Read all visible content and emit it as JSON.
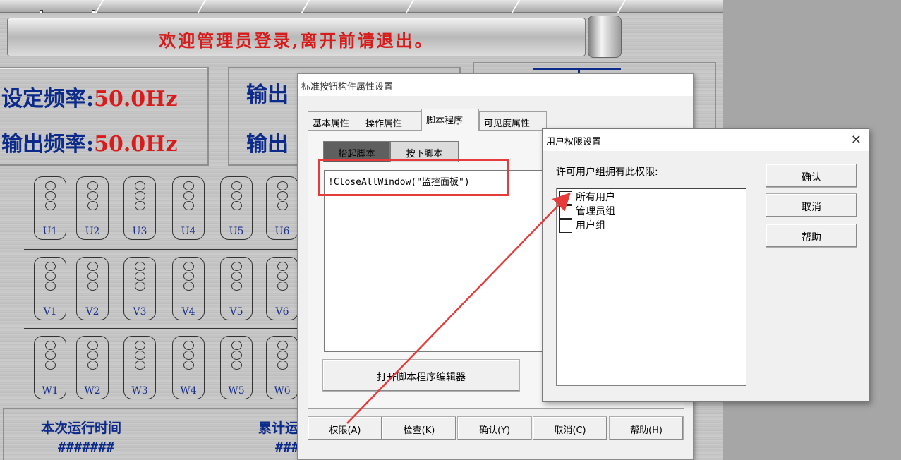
{
  "scada": {
    "banner": "欢迎管理员登录,离开前请退出。",
    "freq_set_label": "设定频率:",
    "freq_set_value": "50.0Hz",
    "freq_out_label": "输出频率:",
    "freq_out_value": "50.0Hz",
    "out_label_1": "输出",
    "out_label_2": "输出",
    "cells_u": [
      "U1",
      "U2",
      "U3",
      "U4",
      "U5",
      "U6"
    ],
    "cells_v": [
      "V1",
      "V2",
      "V3",
      "V4",
      "V5",
      "V6"
    ],
    "cells_w": [
      "W1",
      "W2",
      "W3",
      "W4",
      "W5",
      "W6"
    ],
    "run_time_label": "本次运行时间",
    "run_time_value": "#######",
    "total_label": "累计运",
    "total_value": "#######",
    "total_value_2": "#######"
  },
  "dialog1": {
    "title": "标准按钮构件属性设置",
    "tabs": [
      "基本属性",
      "操作属性",
      "脚本程序",
      "可见度属性"
    ],
    "subtabs": [
      "抬起脚本",
      "按下脚本"
    ],
    "script": "!CloseAllWindow(\"监控面板\")",
    "open_editor": "打开脚本程序编辑器",
    "buttons": [
      "权限(A)",
      "检查(K)",
      "确认(Y)",
      "取消(C)",
      "帮助(H)"
    ]
  },
  "dialog2": {
    "title": "用户权限设置",
    "close": "✕",
    "label": "许可用户组拥有此权限:",
    "groups": [
      {
        "label": "所有用户",
        "checked": true
      },
      {
        "label": "管理员组",
        "checked": false
      },
      {
        "label": "用户组",
        "checked": false
      }
    ],
    "buttons": [
      "确认",
      "取消",
      "帮助"
    ]
  },
  "colors": {
    "highlight": "#e63b3b",
    "title_blue": "#0c2a8a",
    "value_red": "#d81b1b"
  }
}
